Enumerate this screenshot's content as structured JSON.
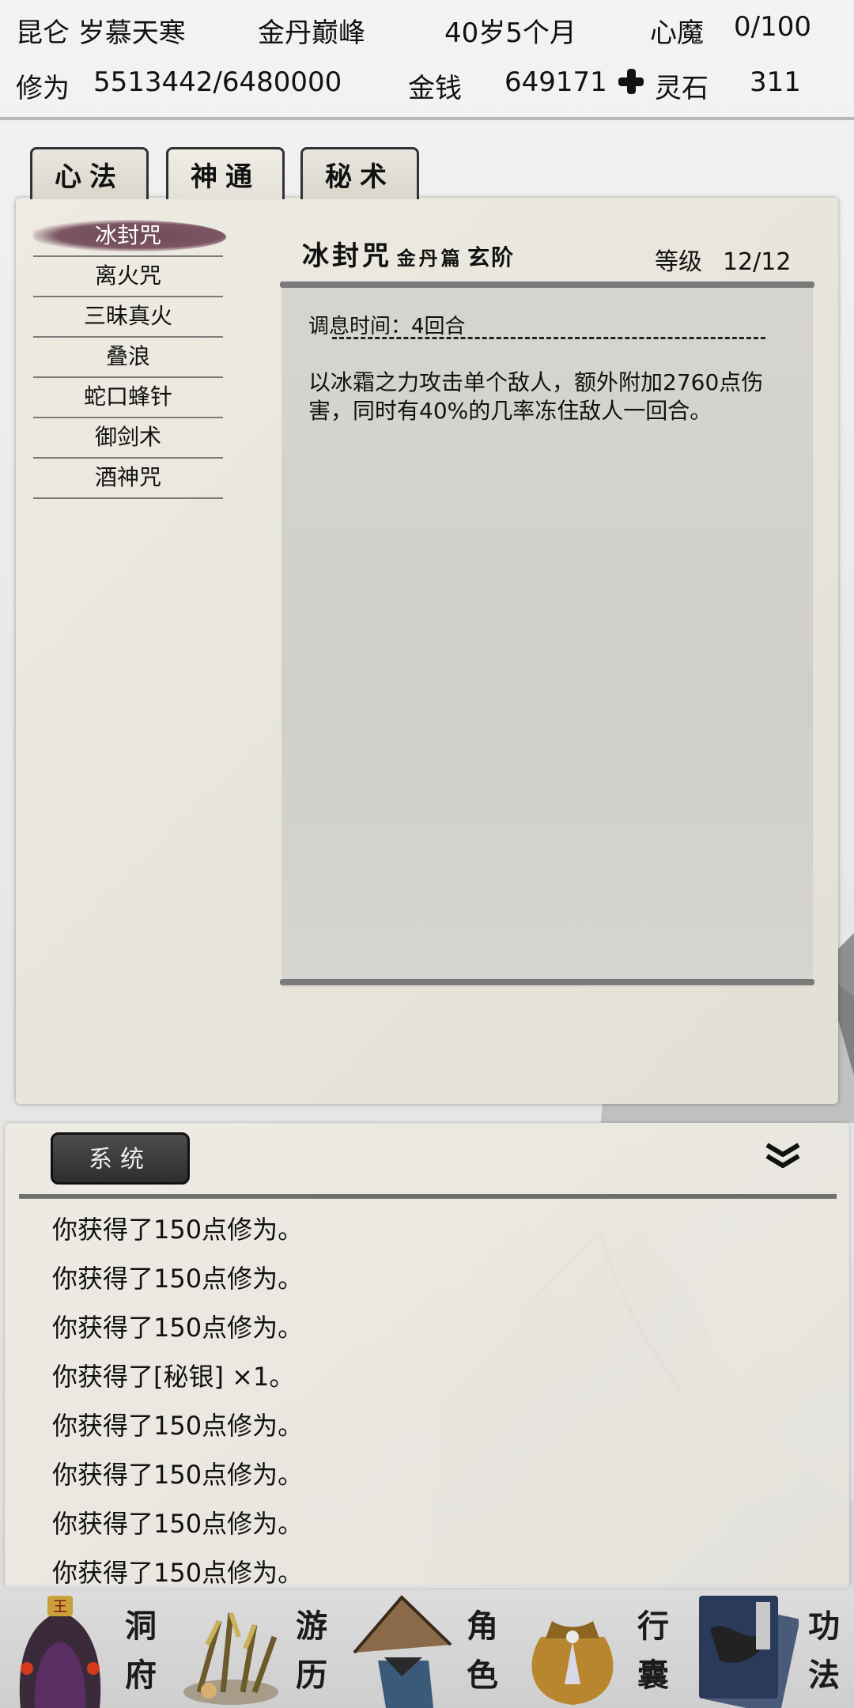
{
  "header": {
    "location": "昆仑 岁慕天寒",
    "realm": "金丹巅峰",
    "age": "40岁5个月",
    "heart_demon_label": "心魔",
    "heart_demon_value": "0/100",
    "cultivation_label": "修为",
    "cultivation_value": "5513442/6480000",
    "money_label": "金钱",
    "money_value": "649171",
    "spirit_stone_label": "灵石",
    "spirit_stone_value": "311"
  },
  "tabs": [
    {
      "label": "心法"
    },
    {
      "label": "神通"
    },
    {
      "label": "秘术"
    }
  ],
  "skills": [
    {
      "name": "冰封咒"
    },
    {
      "name": "离火咒"
    },
    {
      "name": "三昧真火"
    },
    {
      "name": "叠浪"
    },
    {
      "name": "蛇口蜂针"
    },
    {
      "name": "御剑术"
    },
    {
      "name": "酒神咒"
    }
  ],
  "detail": {
    "name": "冰封咒",
    "book": "金丹篇",
    "grade": "玄阶",
    "level_label": "等级",
    "level_value": "12/12",
    "cooldown": "调息时间：4回合",
    "description": "以冰霜之力攻击单个敌人，额外附加2760点伤害，同时有40%的几率冻住敌人一回合。"
  },
  "log": {
    "tab_label": "系统",
    "entries": [
      "你获得了150点修为。",
      "你获得了150点修为。",
      "你获得了150点修为。",
      "你获得了[秘银] ×1。",
      "你获得了150点修为。",
      "你获得了150点修为。",
      "你获得了150点修为。",
      "你获得了150点修为。"
    ]
  },
  "nav": [
    {
      "top": "洞",
      "bottom": "府",
      "icon": "cave-icon"
    },
    {
      "top": "游",
      "bottom": "历",
      "icon": "travel-icon"
    },
    {
      "top": "角",
      "bottom": "色",
      "icon": "character-icon"
    },
    {
      "top": "行",
      "bottom": "囊",
      "icon": "bag-icon"
    },
    {
      "top": "功",
      "bottom": "法",
      "icon": "book-icon"
    }
  ],
  "colors": {
    "selected_skill_brush": "#6e4a56",
    "panel": "#eae7de",
    "rule": "#7a7a7a"
  }
}
